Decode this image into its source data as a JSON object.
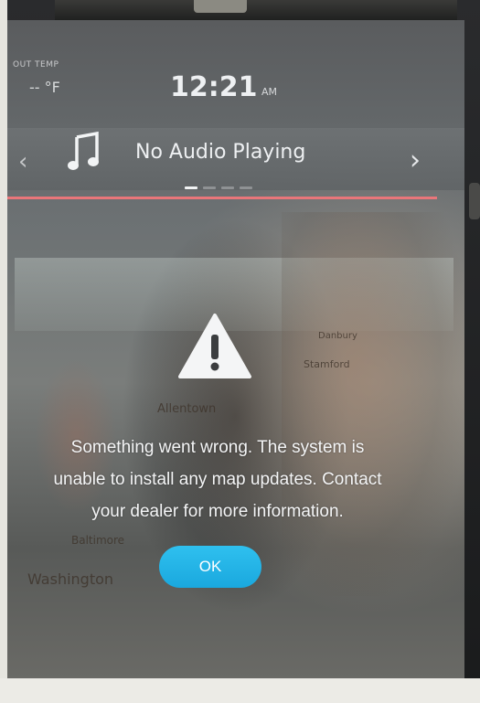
{
  "status": {
    "out_temp_label": "OUT TEMP",
    "out_temp_value": "-- °F",
    "clock": "12:21",
    "ampm": "AM"
  },
  "audio": {
    "label": "No Audio Playing",
    "prev_glyph": "‹",
    "next_glyph": "›",
    "page_indicator": {
      "total": 4,
      "active": 1
    }
  },
  "dialog": {
    "icon": "warning-icon",
    "message": "Something went wrong. The system is unable to install any map updates. Contact your dealer for more information.",
    "button_label": "OK",
    "button_color": "#22b3e6"
  },
  "map_labels": [
    "Allentown",
    "Stamford",
    "Baltimore",
    "Washington",
    "Danbury"
  ],
  "colors": {
    "accent_line": "#e9767a",
    "text": "#f4f5f6"
  }
}
